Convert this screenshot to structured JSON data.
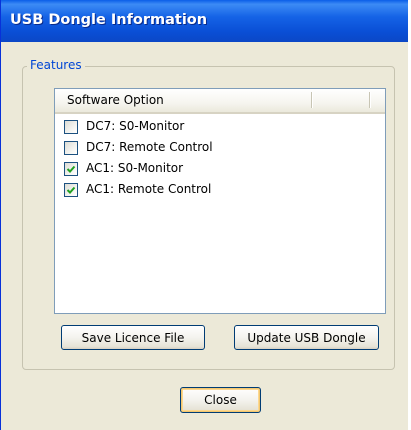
{
  "window": {
    "title": "USB Dongle Information"
  },
  "features": {
    "legend": "Features",
    "column_header": "Software Option",
    "options": [
      {
        "label": "DC7:  S0-Monitor",
        "checked": false
      },
      {
        "label": "DC7:  Remote Control",
        "checked": false
      },
      {
        "label": "AC1:  S0-Monitor",
        "checked": true
      },
      {
        "label": "AC1:  Remote Control",
        "checked": true
      }
    ]
  },
  "buttons": {
    "save_licence": "Save Licence File",
    "update_dongle": "Update USB Dongle",
    "close": "Close"
  },
  "colors": {
    "titlebar": "#0b4fd8",
    "legend_text": "#0046d5",
    "check_mark": "#21a121",
    "dialog_bg": "#ece9d8"
  }
}
